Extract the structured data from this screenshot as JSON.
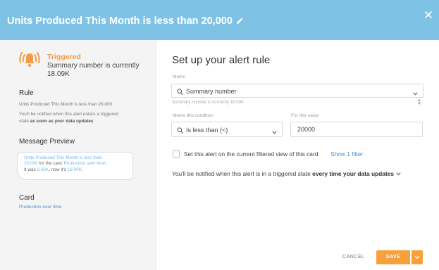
{
  "header": {
    "title": "Units Produced This Month is less than 20,000",
    "background": "#7ec3e6"
  },
  "sidebar": {
    "status": {
      "label": "Triggered",
      "line1": "Summary number is currently",
      "line2": "18.09K",
      "color": "#f49b44",
      "icon": "alarm-bell-icon"
    },
    "rule": {
      "heading": "Rule",
      "description": "Units Produced This Month is less than 20,000",
      "notify_line1": "You'll be notified when this alert enters a triggered",
      "notify_line2_prefix": "state",
      "notify_line2_strong": "as soon as your data updates"
    },
    "message_preview": {
      "heading": "Message Preview",
      "metric_name": "Units Produced This Month is less than",
      "threshold": "20,000",
      "for_the_card": "for the card",
      "card_name": "'Production over time'",
      "period": ".",
      "it_was": "It was",
      "previous_value": "8.36K",
      "now_its": ", now it's",
      "current_value": "18.09K"
    },
    "card": {
      "heading": "Card",
      "link": "Production over time"
    }
  },
  "main": {
    "title": "Set up your alert rule",
    "metric": {
      "label": "Metric",
      "value": "Summary number",
      "hint": "Summary number is currently 18.09K"
    },
    "condition": {
      "label": "Meets this condition",
      "value": "Is less than (<)"
    },
    "threshold": {
      "label": "For this value",
      "value": "20000"
    },
    "filter_checkbox": {
      "label": "Set this alert on the current filtered view of this card",
      "link": "Show 1 filter",
      "checked": false
    },
    "notify": {
      "prefix": "You'll be notified when this alert is in a triggered state",
      "frequency": "every time your data updates"
    }
  },
  "footer": {
    "cancel_label": "CANCEL",
    "save_label": "SAVE",
    "accent": "#f7a13c"
  }
}
